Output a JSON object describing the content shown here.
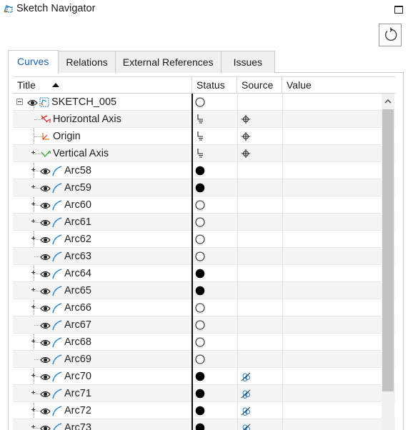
{
  "window": {
    "title": "Sketch Navigator",
    "app_icon": "sketch-navigator-icon",
    "maximize_icon": "maximize-icon",
    "reset_icon": "reset-icon"
  },
  "tabs": [
    {
      "label": "Curves",
      "active": true
    },
    {
      "label": "Relations",
      "active": false
    },
    {
      "label": "External References",
      "active": false
    },
    {
      "label": "Issues",
      "active": false
    }
  ],
  "columns": {
    "title": "Title",
    "status": "Status",
    "source": "Source",
    "value": "Value"
  },
  "rows": [
    {
      "label": "SKETCH_005",
      "kind": "sketch",
      "expander": "minus",
      "eye": true,
      "status": "open",
      "source": ""
    },
    {
      "label": "Horizontal Axis",
      "kind": "h-axis",
      "expander": "none",
      "eye": false,
      "status": "ground",
      "source": "crosshair"
    },
    {
      "label": "Origin",
      "kind": "origin",
      "expander": "none",
      "eye": false,
      "status": "ground",
      "source": "crosshair"
    },
    {
      "label": "Vertical Axis",
      "kind": "v-axis",
      "expander": "plus",
      "eye": false,
      "status": "ground",
      "source": "crosshair"
    },
    {
      "label": "Arc58",
      "kind": "arc",
      "expander": "plus",
      "eye": true,
      "status": "filled",
      "source": ""
    },
    {
      "label": "Arc59",
      "kind": "arc",
      "expander": "plus",
      "eye": true,
      "status": "filled",
      "source": ""
    },
    {
      "label": "Arc60",
      "kind": "arc",
      "expander": "plus",
      "eye": true,
      "status": "open",
      "source": ""
    },
    {
      "label": "Arc61",
      "kind": "arc",
      "expander": "plus",
      "eye": true,
      "status": "open",
      "source": ""
    },
    {
      "label": "Arc62",
      "kind": "arc",
      "expander": "plus",
      "eye": true,
      "status": "open",
      "source": ""
    },
    {
      "label": "Arc63",
      "kind": "arc",
      "expander": "none",
      "eye": true,
      "status": "open",
      "source": ""
    },
    {
      "label": "Arc64",
      "kind": "arc",
      "expander": "plus",
      "eye": true,
      "status": "filled",
      "source": ""
    },
    {
      "label": "Arc65",
      "kind": "arc",
      "expander": "plus",
      "eye": true,
      "status": "filled",
      "source": ""
    },
    {
      "label": "Arc66",
      "kind": "arc",
      "expander": "plus",
      "eye": true,
      "status": "open",
      "source": ""
    },
    {
      "label": "Arc67",
      "kind": "arc",
      "expander": "none",
      "eye": true,
      "status": "open",
      "source": ""
    },
    {
      "label": "Arc68",
      "kind": "arc",
      "expander": "plus",
      "eye": true,
      "status": "open",
      "source": ""
    },
    {
      "label": "Arc69",
      "kind": "arc",
      "expander": "none",
      "eye": true,
      "status": "open",
      "source": ""
    },
    {
      "label": "Arc70",
      "kind": "arc",
      "expander": "plus",
      "eye": true,
      "status": "filled",
      "source": "external"
    },
    {
      "label": "Arc71",
      "kind": "arc",
      "expander": "plus",
      "eye": true,
      "status": "filled",
      "source": "external"
    },
    {
      "label": "Arc72",
      "kind": "arc",
      "expander": "plus",
      "eye": true,
      "status": "filled",
      "source": "external"
    },
    {
      "label": "Arc73",
      "kind": "arc",
      "expander": "plus",
      "eye": true,
      "status": "filled",
      "source": "external"
    }
  ],
  "colors": {
    "active_tab_text": "#1b5fa8",
    "arc_icon": "#1f7fc4",
    "axis_red": "#d8232a",
    "axis_green": "#3aa637",
    "origin_orange": "#e07a1f"
  }
}
